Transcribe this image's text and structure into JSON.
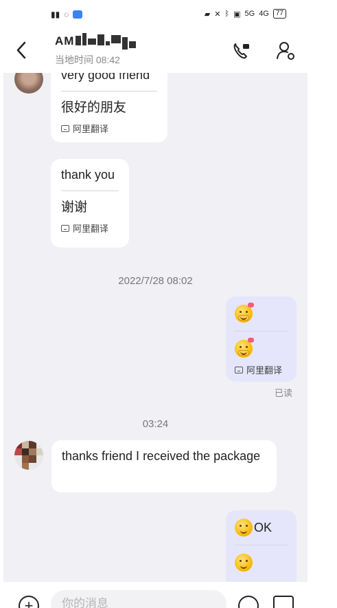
{
  "status_bar": {
    "left_icons": [
      "notification-icon",
      "wifi-icon",
      "app-icon"
    ],
    "right_icons": [
      "camera-icon",
      "mute-icon",
      "bluetooth-icon",
      "screen-icon"
    ],
    "signal_1": "5G",
    "signal_2": "4G",
    "battery": "77"
  },
  "header": {
    "contact_name": "AM",
    "local_time": "当地时间 08:42"
  },
  "messages": [
    {
      "direction": "in",
      "original": "very good friend",
      "translation": "很好的朋友",
      "credit": "阿里翻译"
    },
    {
      "direction": "in",
      "original": "thank you",
      "translation": "谢谢",
      "credit": "阿里翻译"
    },
    {
      "direction": "out",
      "original_emoji": "shy-face-emoji",
      "translation_emoji": "shy-face-emoji",
      "credit": "阿里翻译",
      "status": "已读"
    },
    {
      "direction": "in",
      "text": "thanks friend I received the package"
    },
    {
      "direction": "out",
      "original_text": "OK",
      "original_emoji": "smile-emoji",
      "translation_emoji": "smile-emoji"
    }
  ],
  "timestamps": [
    "2022/7/28 08:02",
    "03:24"
  ],
  "input": {
    "placeholder": "你的消息"
  },
  "colors": {
    "chat_background": "#f0f0f5",
    "incoming_bubble": "#ffffff",
    "outgoing_bubble": "#e5e6fb"
  }
}
